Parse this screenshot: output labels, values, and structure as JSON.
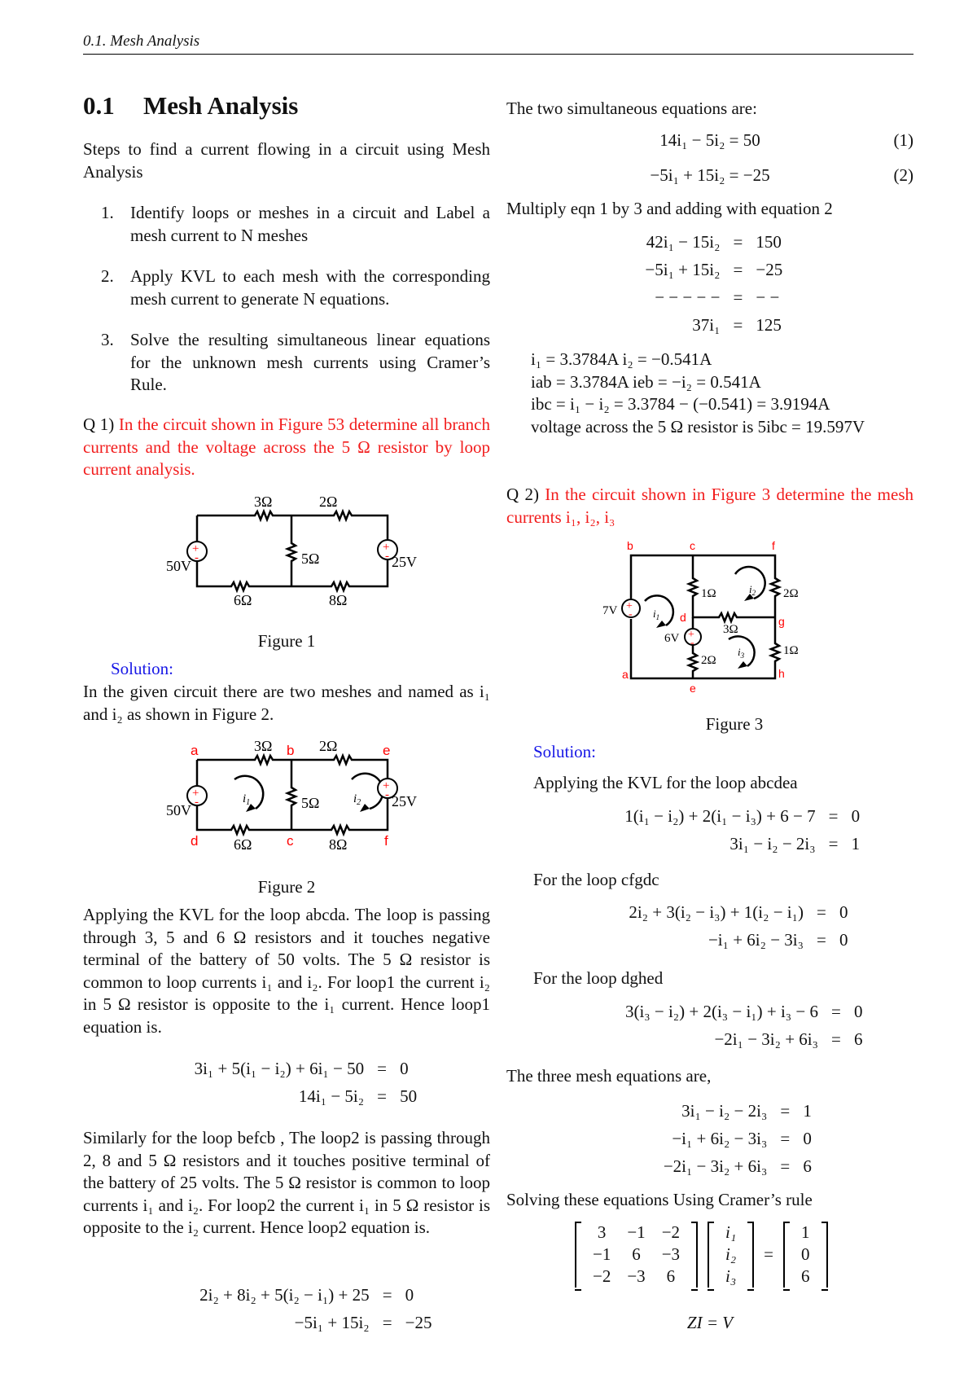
{
  "header": {
    "running_head": "0.1.   Mesh Analysis"
  },
  "section": {
    "number": "0.1",
    "title": "Mesh Analysis"
  },
  "intro": "Steps to find a current flowing in a circuit using Mesh Analysis",
  "steps": [
    {
      "num": "1.",
      "text": "Identify loops or meshes in a circuit and Label a mesh current to N meshes"
    },
    {
      "num": "2.",
      "text": "Apply KVL to each mesh with the corresponding mesh current to generate N equations."
    },
    {
      "num": "3.",
      "text": "Solve the resulting simultaneous linear equations for the unknown mesh currents using Cramer’s Rule."
    }
  ],
  "q1": {
    "label": "Q 1)",
    "text": "In the circuit shown in Figure 53 determine all branch currents and the voltage across the 5 Ω resistor by loop current analysis.",
    "figure1": {
      "caption": "Figure 1",
      "labels": {
        "r_top_left": "3Ω",
        "r_top_right": "2Ω",
        "r_mid": "5Ω",
        "r_bot_left": "6Ω",
        "r_bot_right": "8Ω",
        "v_left": "50V",
        "v_right": "25V",
        "plus": "+",
        "minus": "-"
      }
    },
    "solution_label": "Solution:",
    "solution_intro": "In the given circuit there are two meshes and named as i₁ and i₂ as shown in Figure 2.",
    "figure2": {
      "caption": "Figure 2",
      "nodes": {
        "a": "a",
        "b": "b",
        "c": "c",
        "d": "d",
        "e": "e",
        "f": "f"
      },
      "currents": {
        "i1": "i",
        "i1_sub": "1",
        "i2": "i",
        "i2_sub": "2"
      }
    },
    "loop1_text": "Applying the KVL for the loop abcda. The loop is passing through 3, 5 and 6 Ω resistors and it touches negative terminal of the battery of 50 volts. The 5 Ω resistor is common to loop currents i₁ and i₂. For loop1 the current i₂ in 5 Ω resistor is opposite to the i₁ current. Hence loop1 equation is.",
    "loop1_eqs": [
      {
        "lhs": "3i₁ + 5(i₁ − i₂) + 6i₁ − 50",
        "eq": "=",
        "rhs": "0"
      },
      {
        "lhs": "14i₁ − 5i₂",
        "eq": "=",
        "rhs": "50"
      }
    ],
    "loop2_text": "Similarly for the loop befcb , The loop2 is passing through 2, 8 and 5 Ω resistors and it touches positive terminal of the battery of 25 volts. The 5 Ω resistor is common to loop currents i₁ and i₂. For loop2 the current i₁ in 5 Ω resistor is opposite to the i₂ current. Hence loop2 equation is.",
    "loop2_eqs": [
      {
        "lhs": "2i₂ + 8i₂ + 5(i₂ − i₁) + 25",
        "eq": "=",
        "rhs": "0"
      },
      {
        "lhs": "−5i₁ + 15i₂",
        "eq": "=",
        "rhs": "−25"
      }
    ],
    "simul_intro": "The two simultaneous equations are:",
    "simul_eqs": [
      {
        "eq": "14i₁ − 5i₂ = 50",
        "num": "(1)"
      },
      {
        "eq": "−5i₁ + 15i₂ = −25",
        "num": "(2)"
      }
    ],
    "multiply_text": "Multiply eqn 1 by 3 and adding with equation 2",
    "elim_eqs": [
      {
        "lhs": "42i₁ − 15i₂",
        "eq": "=",
        "rhs": "150"
      },
      {
        "lhs": "−5i₁ + 15i₂",
        "eq": "=",
        "rhs": "−25"
      },
      {
        "lhs": "− − − − −",
        "eq": "=",
        "rhs": "− −"
      },
      {
        "lhs": "37i₁",
        "eq": "=",
        "rhs": "125"
      }
    ],
    "results": [
      "i₁ = 3.3784A    i₂ = −0.541A",
      "iab = 3.3784A    ieb = −i₂ = 0.541A",
      "ibc = i₁ − i₂ = 3.3784 − (−0.541) = 3.9194A",
      "voltage across the 5 Ω resistor is 5ibc = 19.597V"
    ]
  },
  "q2": {
    "label": "Q 2)",
    "text": "In the circuit shown in Figure 3 determine the mesh currents i₁, i₂, i₃",
    "figure3": {
      "caption": "Figure 3",
      "nodes": {
        "a": "a",
        "b": "b",
        "c": "c",
        "d": "d",
        "e": "e",
        "f": "f",
        "g": "g",
        "h": "h"
      },
      "labels": {
        "r_cd": "1Ω",
        "r_fg": "2Ω",
        "r_dg": "3Ω",
        "r_de": "2Ω",
        "r_gh": "1Ω",
        "v_left": "7V",
        "v_mid": "6V"
      }
    },
    "solution_label": "Solution:",
    "loop_abcdea_text": "Applying the KVL for the loop abcdea",
    "loop_abcdea_eqs": [
      {
        "lhs": "1(i₁ − i₂) + 2(i₁ − i₃) + 6 − 7",
        "eq": "=",
        "rhs": "0"
      },
      {
        "lhs": "3i₁ − i₂ − 2i₃",
        "eq": "=",
        "rhs": "1"
      }
    ],
    "loop_cfgdc_text": "For the loop cfgdc",
    "loop_cfgdc_eqs": [
      {
        "lhs": "2i₂ + 3(i₂ − i₃) + 1(i₂ − i₁)",
        "eq": "=",
        "rhs": "0"
      },
      {
        "lhs": "−i₁ + 6i₂ − 3i₃",
        "eq": "=",
        "rhs": "0"
      }
    ],
    "loop_dghed_text": "For the loop dghed",
    "loop_dghed_eqs": [
      {
        "lhs": "3(i₃ − i₂) + 2(i₃ − i₁) + i₃ − 6",
        "eq": "=",
        "rhs": "0"
      },
      {
        "lhs": "−2i₁ − 3i₂ + 6i₃",
        "eq": "=",
        "rhs": "6"
      }
    ],
    "three_eq_text": "The three mesh equations are,",
    "three_eqs": [
      {
        "lhs": "3i₁ − i₂ − 2i₃",
        "eq": "=",
        "rhs": "1"
      },
      {
        "lhs": "−i₁ + 6i₂ − 3i₃",
        "eq": "=",
        "rhs": "0"
      },
      {
        "lhs": "−2i₁ − 3i₂ + 6i₃",
        "eq": "=",
        "rhs": "6"
      }
    ],
    "cramer_text": "Solving these equations Using Cramer’s rule",
    "matrix_Z": [
      [
        "3",
        "−1",
        "−2"
      ],
      [
        "−1",
        "6",
        "−3"
      ],
      [
        "−2",
        "−3",
        "6"
      ]
    ],
    "vector_I": [
      "i₁",
      "i₂",
      "i₃"
    ],
    "vector_V": [
      "1",
      "0",
      "6"
    ],
    "matrix_eq": "=",
    "zi_eq": "ZI = V"
  },
  "colors": {
    "question": "#f21c1c",
    "solution": "#1717e6",
    "node_label": "#ff0000",
    "text": "#111111"
  }
}
